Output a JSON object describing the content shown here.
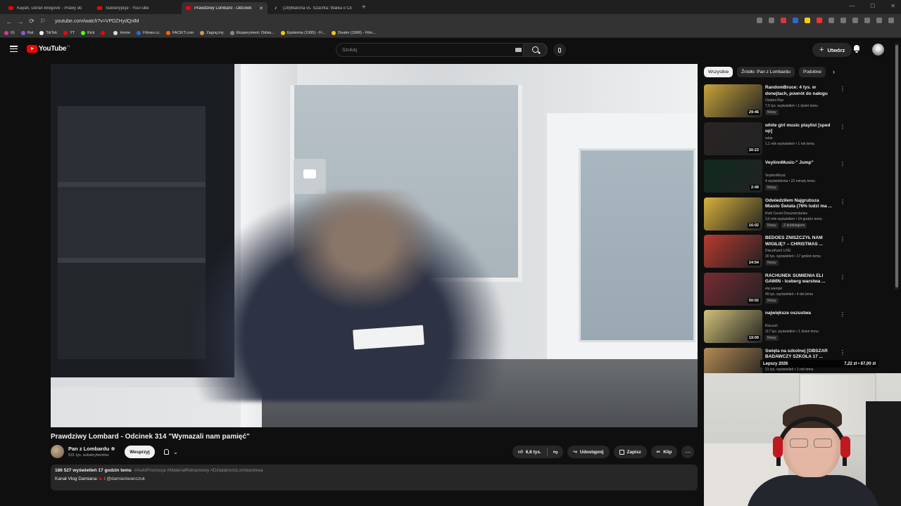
{
  "browser": {
    "tabs": [
      {
        "title": "Kayah, Goran Bregović - Prawy do",
        "active": false
      },
      {
        "title": "Subskrypcje - YouTube",
        "active": false
      },
      {
        "title": "Prawdziwy Lombard - Odcinek",
        "active": true
      },
      {
        "title": "(28)Malicha vs. Szachta: Walka o Clip",
        "active": false
      }
    ],
    "url": "youtube.com/watch?v=VPDZHydQnlM",
    "bookmarks": [
      "IG",
      "Rat",
      "TikTok",
      "YT",
      "Kick",
      "",
      "Home",
      "Filman.cc",
      "FACEIT.com",
      "Zagraj.my",
      "Eksperyment: Odsia...",
      "Epidemia (1995) - Fi...",
      "Dealer (1996) - Film..."
    ]
  },
  "header": {
    "logo_text": "YouTube",
    "country_code": "PL",
    "search_placeholder": "Szukaj",
    "create_label": "Utwórz"
  },
  "video": {
    "title": "Prawdziwy Lombard - Odcinek 314 \"Wymazali nam pamięć\"",
    "channel": "Pan z Lombardu",
    "subscribers": "531 tys. subskrybentów",
    "support_label": "Wesprzyj",
    "likes": "6,6 tys.",
    "share_label": "Udostępnij",
    "save_label": "Zapisz",
    "clip_label": "Klip",
    "description": {
      "views_time": "186 527 wyświetleń  17 godzin temu",
      "tags": "#AutoPromocja #MateriałReklamowy #DziałalnośćLombardowa",
      "line2_prefix": "Kanał Vlog Damiana:",
      "line2_handle": "/ @damianiwanczuk"
    }
  },
  "chips": [
    "Wszystkie",
    "Źródło: Pan z Lombardu",
    "Podobne"
  ],
  "recommendations": [
    {
      "title": "RandomBruce: 4 tys. w donejtach, powrót do nałogu",
      "channel": "Ostatni Raz",
      "meta": "7,5 tys. wyświetleń • 1 dzień temu",
      "badge": "Nowy",
      "badge2": "",
      "duration": "29:46",
      "thumb_color": "#c8a33a"
    },
    {
      "title": "white girl music playlist [sped up]",
      "channel": "solar",
      "meta": "1,1 mln wyświetleń • 1 rok temu",
      "badge": "",
      "badge2": "",
      "duration": "30:23",
      "thumb_color": "#2a2424"
    },
    {
      "title": "VeylinnMusic-\" Jump\"",
      "channel": "VeylinnMusic",
      "meta": "4 wyświetlenia • 22 minuty temu",
      "badge": "Nowy",
      "badge2": "",
      "duration": "2:49",
      "thumb_color": "#0f2a1f"
    },
    {
      "title": "Odwiedziłem Najgrubsza Miasto Świata (76% ludzi ma ...",
      "channel": "Ruhi Cenet Documentaries",
      "meta": "3,6 mln wyświetleń • 14 godzin temu",
      "badge": "Nowy",
      "badge2": "Z dubbingiem",
      "duration": "16:02",
      "thumb_color": "#d9b23a"
    },
    {
      "title": "BEDOES ZNISZCZYŁ NAM WIGILIĘ? – CHRISTMAS ...",
      "channel": "DiscoKarol LIVE",
      "meta": "30 tys. wyświetleń • 17 godzin temu",
      "badge": "Nowy",
      "badge2": "",
      "duration": "24:54",
      "thumb_color": "#b83a2e"
    },
    {
      "title": "RACHUNEK SUMIENIA ELI GAWIN - Iceberg warstwa ...",
      "channel": "ela wampir",
      "meta": "49 tys. wyświetleń • 4 dni temu",
      "badge": "Nowy",
      "badge2": "",
      "duration": "50:02",
      "thumb_color": "#7a2b33"
    },
    {
      "title": "największe oszustwa",
      "channel": "Klocuch",
      "meta": "117 tys. wyświetleń • 1 dzień temu",
      "badge": "Nowy",
      "badge2": "",
      "duration": "19:09",
      "thumb_color": "#d2c27a"
    },
    {
      "title": "Święta na szkolnej [OBSZAR BADAWCZY SZKOŁA 17 ...",
      "channel": "",
      "meta": "21 tys. wyświetleń • 1 rok temu",
      "badge": "",
      "badge2": "",
      "duration": "",
      "thumb_color": "#b58a52"
    }
  ],
  "overlay": {
    "left": "Lepszy 2026",
    "right": "7,22 zł • 67,00 zł"
  },
  "colors": {
    "accent": "#ff0000",
    "background": "#0f0f0f",
    "surface": "#272727"
  }
}
